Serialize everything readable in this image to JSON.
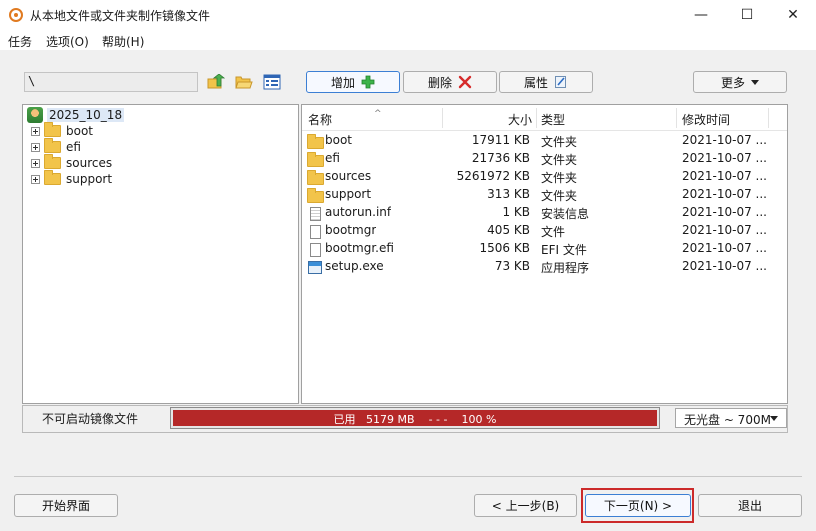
{
  "window": {
    "title": "从本地文件或文件夹制作镜像文件",
    "minimize_glyph": "—",
    "maximize_glyph": "☐",
    "close_glyph": "✕"
  },
  "menu": [
    "任务",
    "选项(O)",
    "帮助(H)"
  ],
  "toolbar": {
    "path_value": "\\",
    "add_label": "增加",
    "delete_label": "删除",
    "properties_label": "属性",
    "more_label": "更多"
  },
  "tree": {
    "root": "2025_10_18",
    "children": [
      "boot",
      "efi",
      "sources",
      "support"
    ]
  },
  "list": {
    "columns": {
      "name": "名称",
      "size": "大小",
      "type": "类型",
      "modified": "修改时间"
    },
    "rows": [
      {
        "name": "boot",
        "size": "17911 KB",
        "type": "文件夹",
        "modified": "2021-10-07 ...",
        "icon": "folder"
      },
      {
        "name": "efi",
        "size": "21736 KB",
        "type": "文件夹",
        "modified": "2021-10-07 ...",
        "icon": "folder"
      },
      {
        "name": "sources",
        "size": "5261972 KB",
        "type": "文件夹",
        "modified": "2021-10-07 ...",
        "icon": "folder"
      },
      {
        "name": "support",
        "size": "313 KB",
        "type": "文件夹",
        "modified": "2021-10-07 ...",
        "icon": "folder"
      },
      {
        "name": "autorun.inf",
        "size": "1 KB",
        "type": "安装信息",
        "modified": "2021-10-07 ...",
        "icon": "inf"
      },
      {
        "name": "bootmgr",
        "size": "405 KB",
        "type": "文件",
        "modified": "2021-10-07 ...",
        "icon": "file"
      },
      {
        "name": "bootmgr.efi",
        "size": "1506 KB",
        "type": "EFI 文件",
        "modified": "2021-10-07 ...",
        "icon": "file"
      },
      {
        "name": "setup.exe",
        "size": "73 KB",
        "type": "应用程序",
        "modified": "2021-10-07 ...",
        "icon": "exe"
      }
    ]
  },
  "status": {
    "label": "不可启动镜像文件",
    "used_prefix": "已用",
    "used_size": "5179 MB",
    "separator": "- - -",
    "percent_text": "100 %",
    "percent_value": 100,
    "disc_type": "无光盘 ~ 700M"
  },
  "footer": {
    "start_label": "开始界面",
    "prev_label": "< 上一步(B)",
    "next_label": "下一页(N) >",
    "exit_label": "退出"
  },
  "colors": {
    "progress": "#b52828",
    "highlight": "#cc2a2a",
    "accent": "#3c7fd4"
  }
}
